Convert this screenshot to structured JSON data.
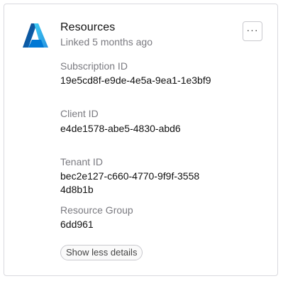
{
  "card": {
    "logo_icon": "azure-logo-icon",
    "title": "Resources",
    "subtitle": "Linked 5 months ago",
    "menu_label": "···",
    "fields": [
      {
        "label": "Subscription ID",
        "value": "19e5cd8f-e9de-4e5a-9ea1-1e3bf9"
      },
      {
        "label": "Client ID",
        "value": "e4de1578-abe5-4830-abd6"
      },
      {
        "label": "Tenant ID",
        "value_line1": "bec2e127-c660-4770-9f9f-3558",
        "value_line2": "4d8b1b"
      },
      {
        "label": "Resource Group",
        "value": "6dd961"
      }
    ],
    "toggle_label": "Show less details"
  },
  "colors": {
    "border": "#d9d9de",
    "muted_text": "#7a7a80",
    "azure_blue_dark": "#0a5ea8",
    "azure_blue_light": "#2f9be8"
  }
}
